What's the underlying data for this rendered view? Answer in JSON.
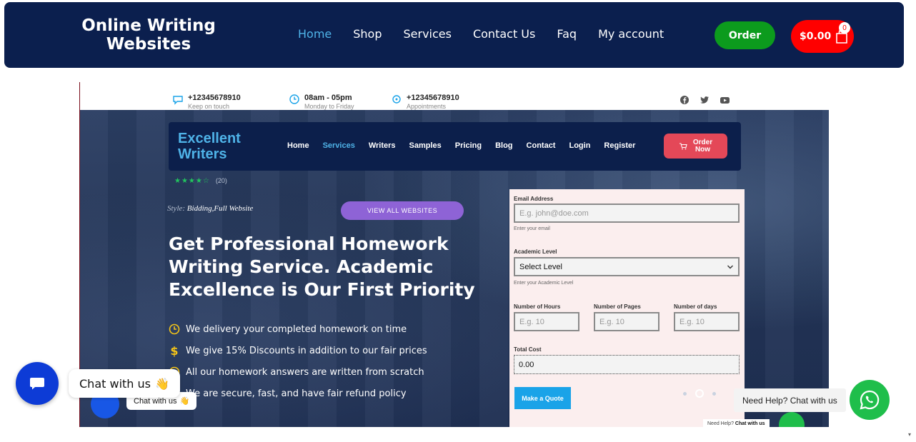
{
  "header": {
    "brand_line1": "Online Writing",
    "brand_line2": "Websites",
    "nav": [
      {
        "label": "Home",
        "active": true
      },
      {
        "label": "Shop"
      },
      {
        "label": "Services"
      },
      {
        "label": "Contact Us"
      },
      {
        "label": "Faq"
      },
      {
        "label": "My account"
      }
    ],
    "order_label": "Order",
    "cart_total": "$0.00",
    "cart_count": "0",
    "colors": {
      "bar": "#0b1f4e",
      "accent": "#4fb3e8",
      "order": "#0c9b1d",
      "cart": "#ff0000"
    }
  },
  "preview": {
    "topbar": {
      "phone": {
        "value": "+12345678910",
        "sub": "Keep on touch"
      },
      "hours": {
        "value": "08am - 05pm",
        "sub": "Monday to Friday"
      },
      "appointments": {
        "value": "+12345678910",
        "sub": "Appointments"
      },
      "social_icons": [
        "facebook-icon",
        "twitter-icon",
        "youtube-icon"
      ]
    },
    "brand_line1": "Excellent",
    "brand_line2": "Writers",
    "nav": [
      "Home",
      "Services",
      "Writers",
      "Samples",
      "Pricing",
      "Blog",
      "Contact",
      "Login",
      "Register"
    ],
    "active_nav": "Services",
    "order_line1": "Order",
    "order_line2": "Now",
    "rating": {
      "stars": "★★★★☆",
      "count": "(20)"
    },
    "style_label": "Style:",
    "style_value": "Bidding,Full Website",
    "view_all": "VIEW ALL WEBSITES",
    "heading": "Get Professional Homework Writing Service. Academic Excellence is Our First Priority",
    "features": [
      {
        "icon": "clock-icon",
        "text": "We delivery your completed homework on time"
      },
      {
        "icon": "dollar-icon",
        "text": "We give 15% Discounts in addition to our fair prices"
      },
      {
        "icon": "check-circle-icon",
        "text": "All our homework answers are written from scratch"
      },
      {
        "icon": "shield-icon",
        "text": "We are secure, fast, and have fair refund policy"
      }
    ],
    "form": {
      "email_label": "Email Address",
      "email_placeholder": "E.g. john@doe.com",
      "email_hint": "Enter your email",
      "level_label": "Academic Level",
      "level_value": "Select Level",
      "level_hint": "Enter your Academic Level",
      "hours_label": "Number of Hours",
      "hours_placeholder": "E.g. 10",
      "pages_label": "Number of Pages",
      "pages_placeholder": "E.g. 10",
      "days_label": "Number of days",
      "days_placeholder": "E.g. 10",
      "total_label": "Total Cost",
      "total_value": "0.00",
      "quote_button": "Make a Quote"
    },
    "mini_chat_label": "Chat with us",
    "mini_help_prefix": "Need Help?",
    "mini_help_suffix": "Chat with us"
  },
  "chat_widget": {
    "label": "Chat with us",
    "emoji": "👋"
  },
  "help_widget": {
    "label": "Need Help? Chat with us"
  }
}
